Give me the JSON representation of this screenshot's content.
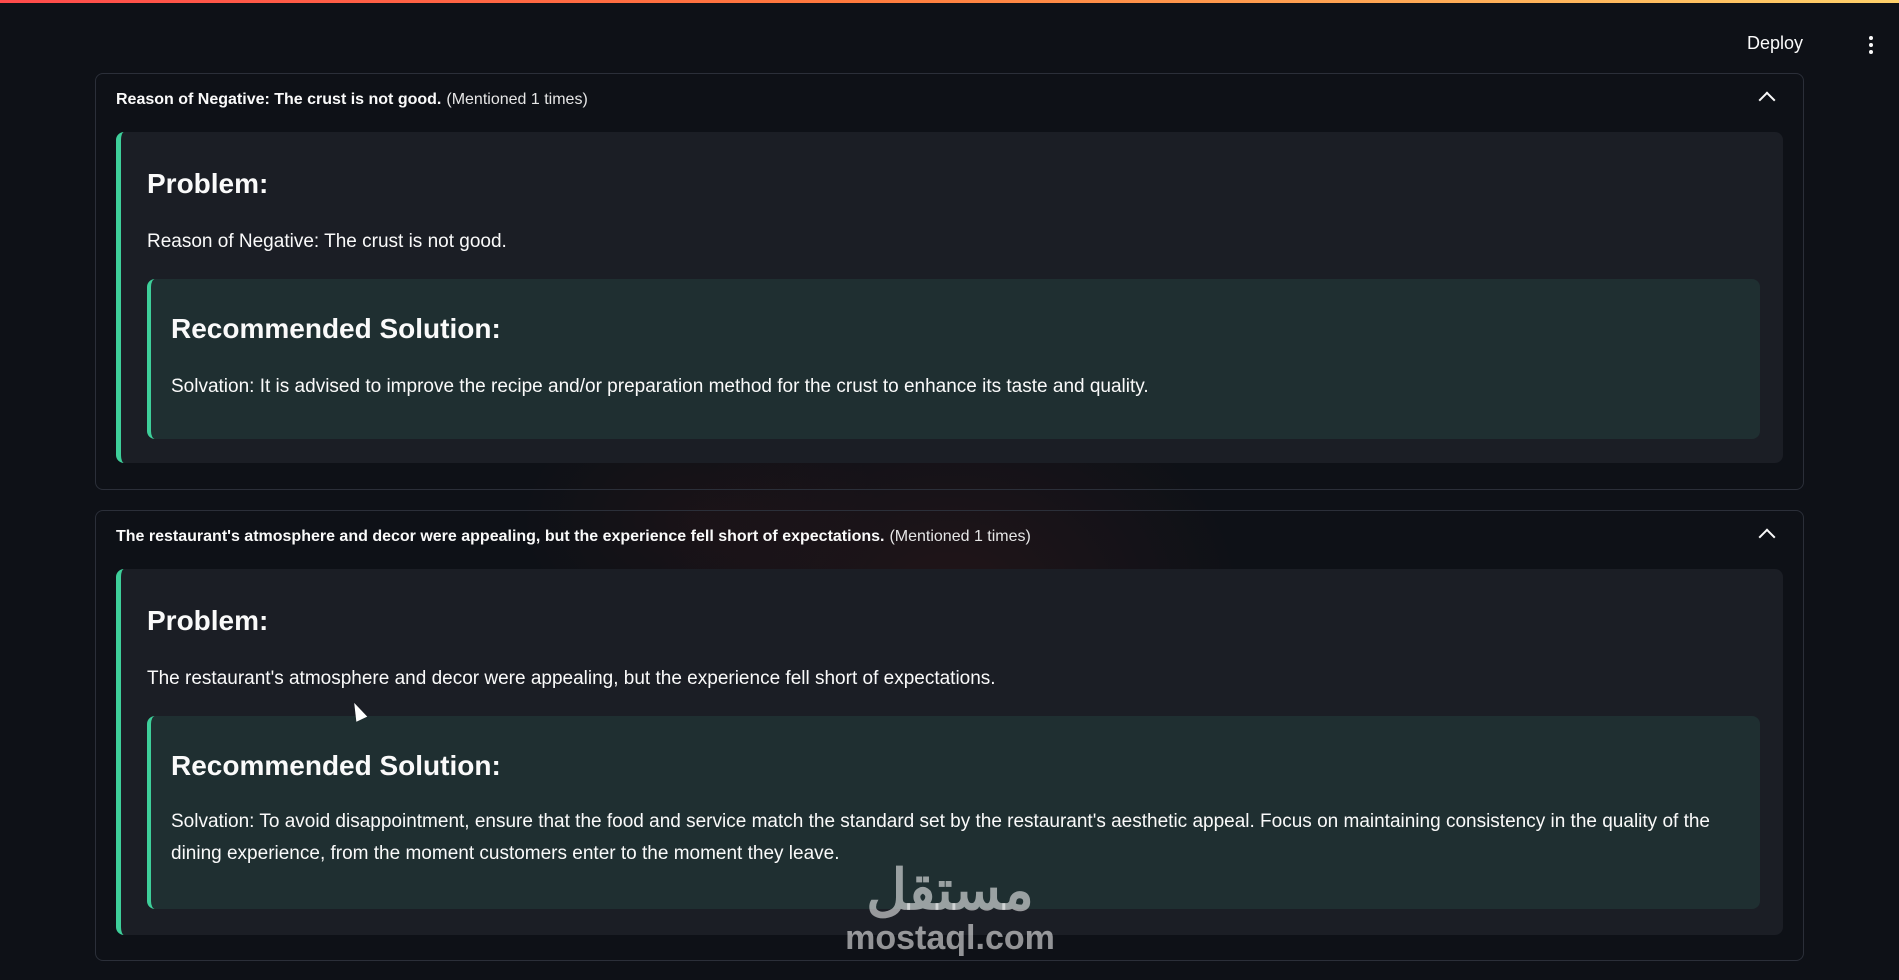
{
  "header": {
    "deploy_label": "Deploy",
    "menu_icon": "kebab-menu-icon"
  },
  "expanders": [
    {
      "title": "Reason of Negative: The crust is not good.",
      "mention": "(Mentioned 1 times)",
      "problem_heading": "Problem:",
      "problem_text": "Reason of Negative: The crust is not good.",
      "solution_heading": "Recommended Solution:",
      "solution_text": "Solvation: It is advised to improve the recipe and/or preparation method for the crust to enhance its taste and quality."
    },
    {
      "title": "The restaurant's atmosphere and decor were appealing, but the experience fell short of expectations.",
      "mention": "(Mentioned 1 times)",
      "problem_heading": "Problem:",
      "problem_text": "The restaurant's atmosphere and decor were appealing, but the experience fell short of expectations.",
      "solution_heading": "Recommended Solution:",
      "solution_text": "Solvation: To avoid disappointment, ensure that the food and service match the standard set by the restaurant's aesthetic appeal. Focus on maintaining consistency in the quality of the dining experience, from the moment customers enter to the moment they leave."
    }
  ],
  "watermark": {
    "arabic": "مستقل",
    "latin": "mostaql.com"
  },
  "colors": {
    "background": "#0e1117",
    "accent": "#3ecf9a",
    "problem_bg": "#1b1e25",
    "solution_bg": "#1f2f31"
  }
}
